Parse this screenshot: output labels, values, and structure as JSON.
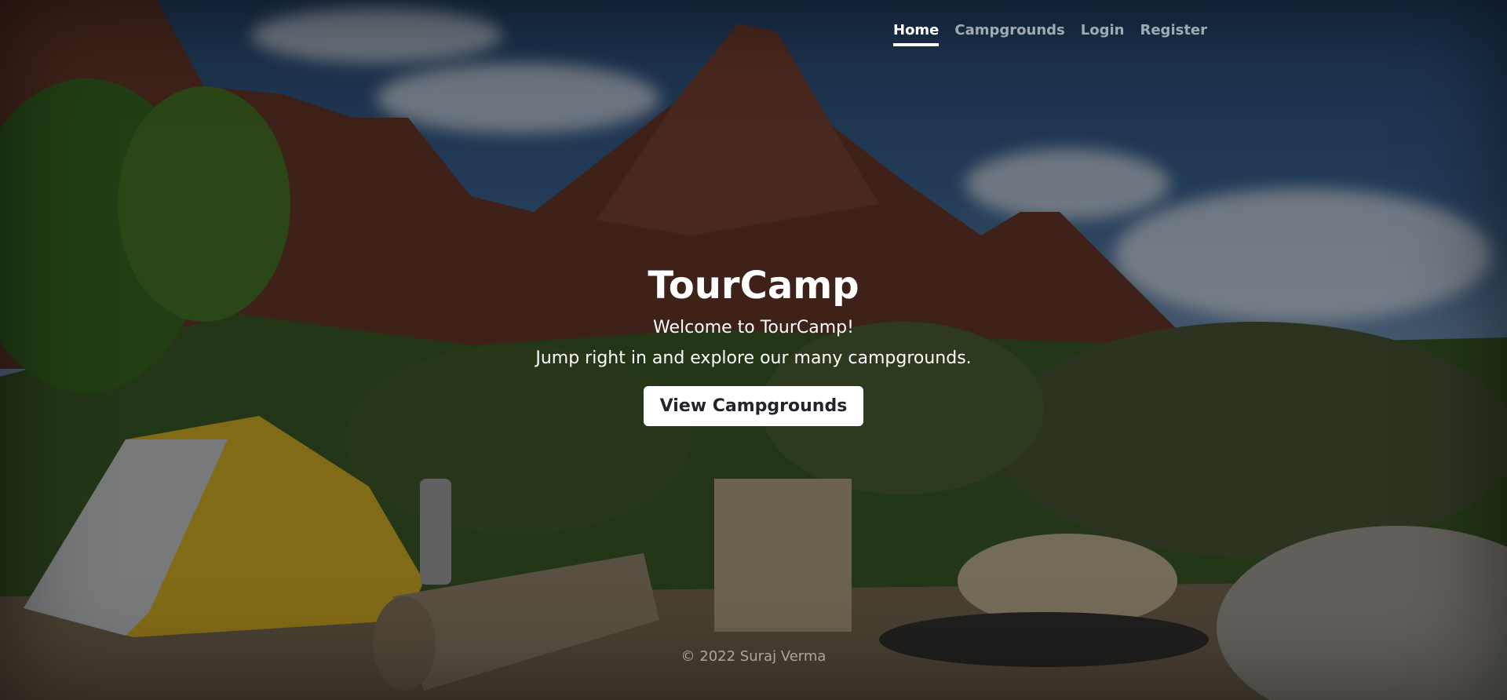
{
  "nav": {
    "items": [
      {
        "label": "Home",
        "active": true
      },
      {
        "label": "Campgrounds",
        "active": false
      },
      {
        "label": "Login",
        "active": false
      },
      {
        "label": "Register",
        "active": false
      }
    ]
  },
  "hero": {
    "title": "TourCamp",
    "welcome": "Welcome to TourCamp!",
    "tagline": "Jump right in and explore our many campgrounds.",
    "cta_label": "View Campgrounds"
  },
  "footer": {
    "text": "© 2022 Suraj Verma"
  },
  "colors": {
    "overlay": "#000000",
    "button_bg": "#ffffff",
    "button_text": "#212529"
  },
  "background": {
    "icon": "campsite-mountain-photo"
  }
}
